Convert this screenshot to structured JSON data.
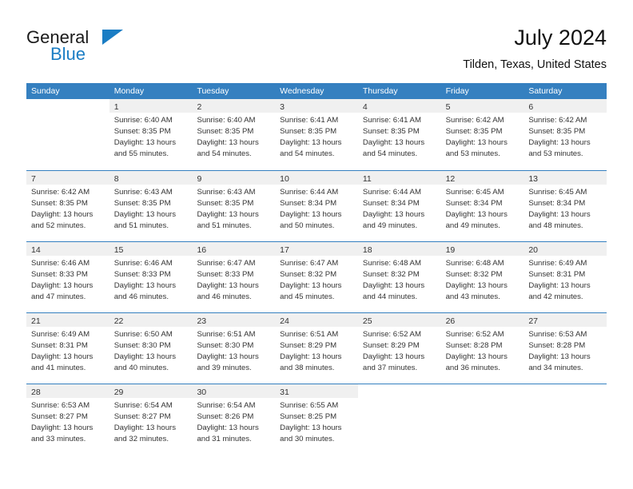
{
  "brand": {
    "name_top": "General",
    "name_bottom": "Blue",
    "accent_color": "#1a7dc4"
  },
  "header": {
    "title": "July 2024",
    "subtitle": "Tilden, Texas, United States"
  },
  "theme": {
    "header_bg": "#3580c0",
    "header_text": "#ffffff",
    "daynum_band_bg": "#f0f0f0",
    "row_divider": "#3580c0",
    "body_text": "#333333"
  },
  "weekdays": [
    "Sunday",
    "Monday",
    "Tuesday",
    "Wednesday",
    "Thursday",
    "Friday",
    "Saturday"
  ],
  "weeks": [
    [
      {
        "day": "",
        "lines": []
      },
      {
        "day": "1",
        "lines": [
          "Sunrise: 6:40 AM",
          "Sunset: 8:35 PM",
          "Daylight: 13 hours",
          "and 55 minutes."
        ]
      },
      {
        "day": "2",
        "lines": [
          "Sunrise: 6:40 AM",
          "Sunset: 8:35 PM",
          "Daylight: 13 hours",
          "and 54 minutes."
        ]
      },
      {
        "day": "3",
        "lines": [
          "Sunrise: 6:41 AM",
          "Sunset: 8:35 PM",
          "Daylight: 13 hours",
          "and 54 minutes."
        ]
      },
      {
        "day": "4",
        "lines": [
          "Sunrise: 6:41 AM",
          "Sunset: 8:35 PM",
          "Daylight: 13 hours",
          "and 54 minutes."
        ]
      },
      {
        "day": "5",
        "lines": [
          "Sunrise: 6:42 AM",
          "Sunset: 8:35 PM",
          "Daylight: 13 hours",
          "and 53 minutes."
        ]
      },
      {
        "day": "6",
        "lines": [
          "Sunrise: 6:42 AM",
          "Sunset: 8:35 PM",
          "Daylight: 13 hours",
          "and 53 minutes."
        ]
      }
    ],
    [
      {
        "day": "7",
        "lines": [
          "Sunrise: 6:42 AM",
          "Sunset: 8:35 PM",
          "Daylight: 13 hours",
          "and 52 minutes."
        ]
      },
      {
        "day": "8",
        "lines": [
          "Sunrise: 6:43 AM",
          "Sunset: 8:35 PM",
          "Daylight: 13 hours",
          "and 51 minutes."
        ]
      },
      {
        "day": "9",
        "lines": [
          "Sunrise: 6:43 AM",
          "Sunset: 8:35 PM",
          "Daylight: 13 hours",
          "and 51 minutes."
        ]
      },
      {
        "day": "10",
        "lines": [
          "Sunrise: 6:44 AM",
          "Sunset: 8:34 PM",
          "Daylight: 13 hours",
          "and 50 minutes."
        ]
      },
      {
        "day": "11",
        "lines": [
          "Sunrise: 6:44 AM",
          "Sunset: 8:34 PM",
          "Daylight: 13 hours",
          "and 49 minutes."
        ]
      },
      {
        "day": "12",
        "lines": [
          "Sunrise: 6:45 AM",
          "Sunset: 8:34 PM",
          "Daylight: 13 hours",
          "and 49 minutes."
        ]
      },
      {
        "day": "13",
        "lines": [
          "Sunrise: 6:45 AM",
          "Sunset: 8:34 PM",
          "Daylight: 13 hours",
          "and 48 minutes."
        ]
      }
    ],
    [
      {
        "day": "14",
        "lines": [
          "Sunrise: 6:46 AM",
          "Sunset: 8:33 PM",
          "Daylight: 13 hours",
          "and 47 minutes."
        ]
      },
      {
        "day": "15",
        "lines": [
          "Sunrise: 6:46 AM",
          "Sunset: 8:33 PM",
          "Daylight: 13 hours",
          "and 46 minutes."
        ]
      },
      {
        "day": "16",
        "lines": [
          "Sunrise: 6:47 AM",
          "Sunset: 8:33 PM",
          "Daylight: 13 hours",
          "and 46 minutes."
        ]
      },
      {
        "day": "17",
        "lines": [
          "Sunrise: 6:47 AM",
          "Sunset: 8:32 PM",
          "Daylight: 13 hours",
          "and 45 minutes."
        ]
      },
      {
        "day": "18",
        "lines": [
          "Sunrise: 6:48 AM",
          "Sunset: 8:32 PM",
          "Daylight: 13 hours",
          "and 44 minutes."
        ]
      },
      {
        "day": "19",
        "lines": [
          "Sunrise: 6:48 AM",
          "Sunset: 8:32 PM",
          "Daylight: 13 hours",
          "and 43 minutes."
        ]
      },
      {
        "day": "20",
        "lines": [
          "Sunrise: 6:49 AM",
          "Sunset: 8:31 PM",
          "Daylight: 13 hours",
          "and 42 minutes."
        ]
      }
    ],
    [
      {
        "day": "21",
        "lines": [
          "Sunrise: 6:49 AM",
          "Sunset: 8:31 PM",
          "Daylight: 13 hours",
          "and 41 minutes."
        ]
      },
      {
        "day": "22",
        "lines": [
          "Sunrise: 6:50 AM",
          "Sunset: 8:30 PM",
          "Daylight: 13 hours",
          "and 40 minutes."
        ]
      },
      {
        "day": "23",
        "lines": [
          "Sunrise: 6:51 AM",
          "Sunset: 8:30 PM",
          "Daylight: 13 hours",
          "and 39 minutes."
        ]
      },
      {
        "day": "24",
        "lines": [
          "Sunrise: 6:51 AM",
          "Sunset: 8:29 PM",
          "Daylight: 13 hours",
          "and 38 minutes."
        ]
      },
      {
        "day": "25",
        "lines": [
          "Sunrise: 6:52 AM",
          "Sunset: 8:29 PM",
          "Daylight: 13 hours",
          "and 37 minutes."
        ]
      },
      {
        "day": "26",
        "lines": [
          "Sunrise: 6:52 AM",
          "Sunset: 8:28 PM",
          "Daylight: 13 hours",
          "and 36 minutes."
        ]
      },
      {
        "day": "27",
        "lines": [
          "Sunrise: 6:53 AM",
          "Sunset: 8:28 PM",
          "Daylight: 13 hours",
          "and 34 minutes."
        ]
      }
    ],
    [
      {
        "day": "28",
        "lines": [
          "Sunrise: 6:53 AM",
          "Sunset: 8:27 PM",
          "Daylight: 13 hours",
          "and 33 minutes."
        ]
      },
      {
        "day": "29",
        "lines": [
          "Sunrise: 6:54 AM",
          "Sunset: 8:27 PM",
          "Daylight: 13 hours",
          "and 32 minutes."
        ]
      },
      {
        "day": "30",
        "lines": [
          "Sunrise: 6:54 AM",
          "Sunset: 8:26 PM",
          "Daylight: 13 hours",
          "and 31 minutes."
        ]
      },
      {
        "day": "31",
        "lines": [
          "Sunrise: 6:55 AM",
          "Sunset: 8:25 PM",
          "Daylight: 13 hours",
          "and 30 minutes."
        ]
      },
      {
        "day": "",
        "lines": []
      },
      {
        "day": "",
        "lines": []
      },
      {
        "day": "",
        "lines": []
      }
    ]
  ]
}
